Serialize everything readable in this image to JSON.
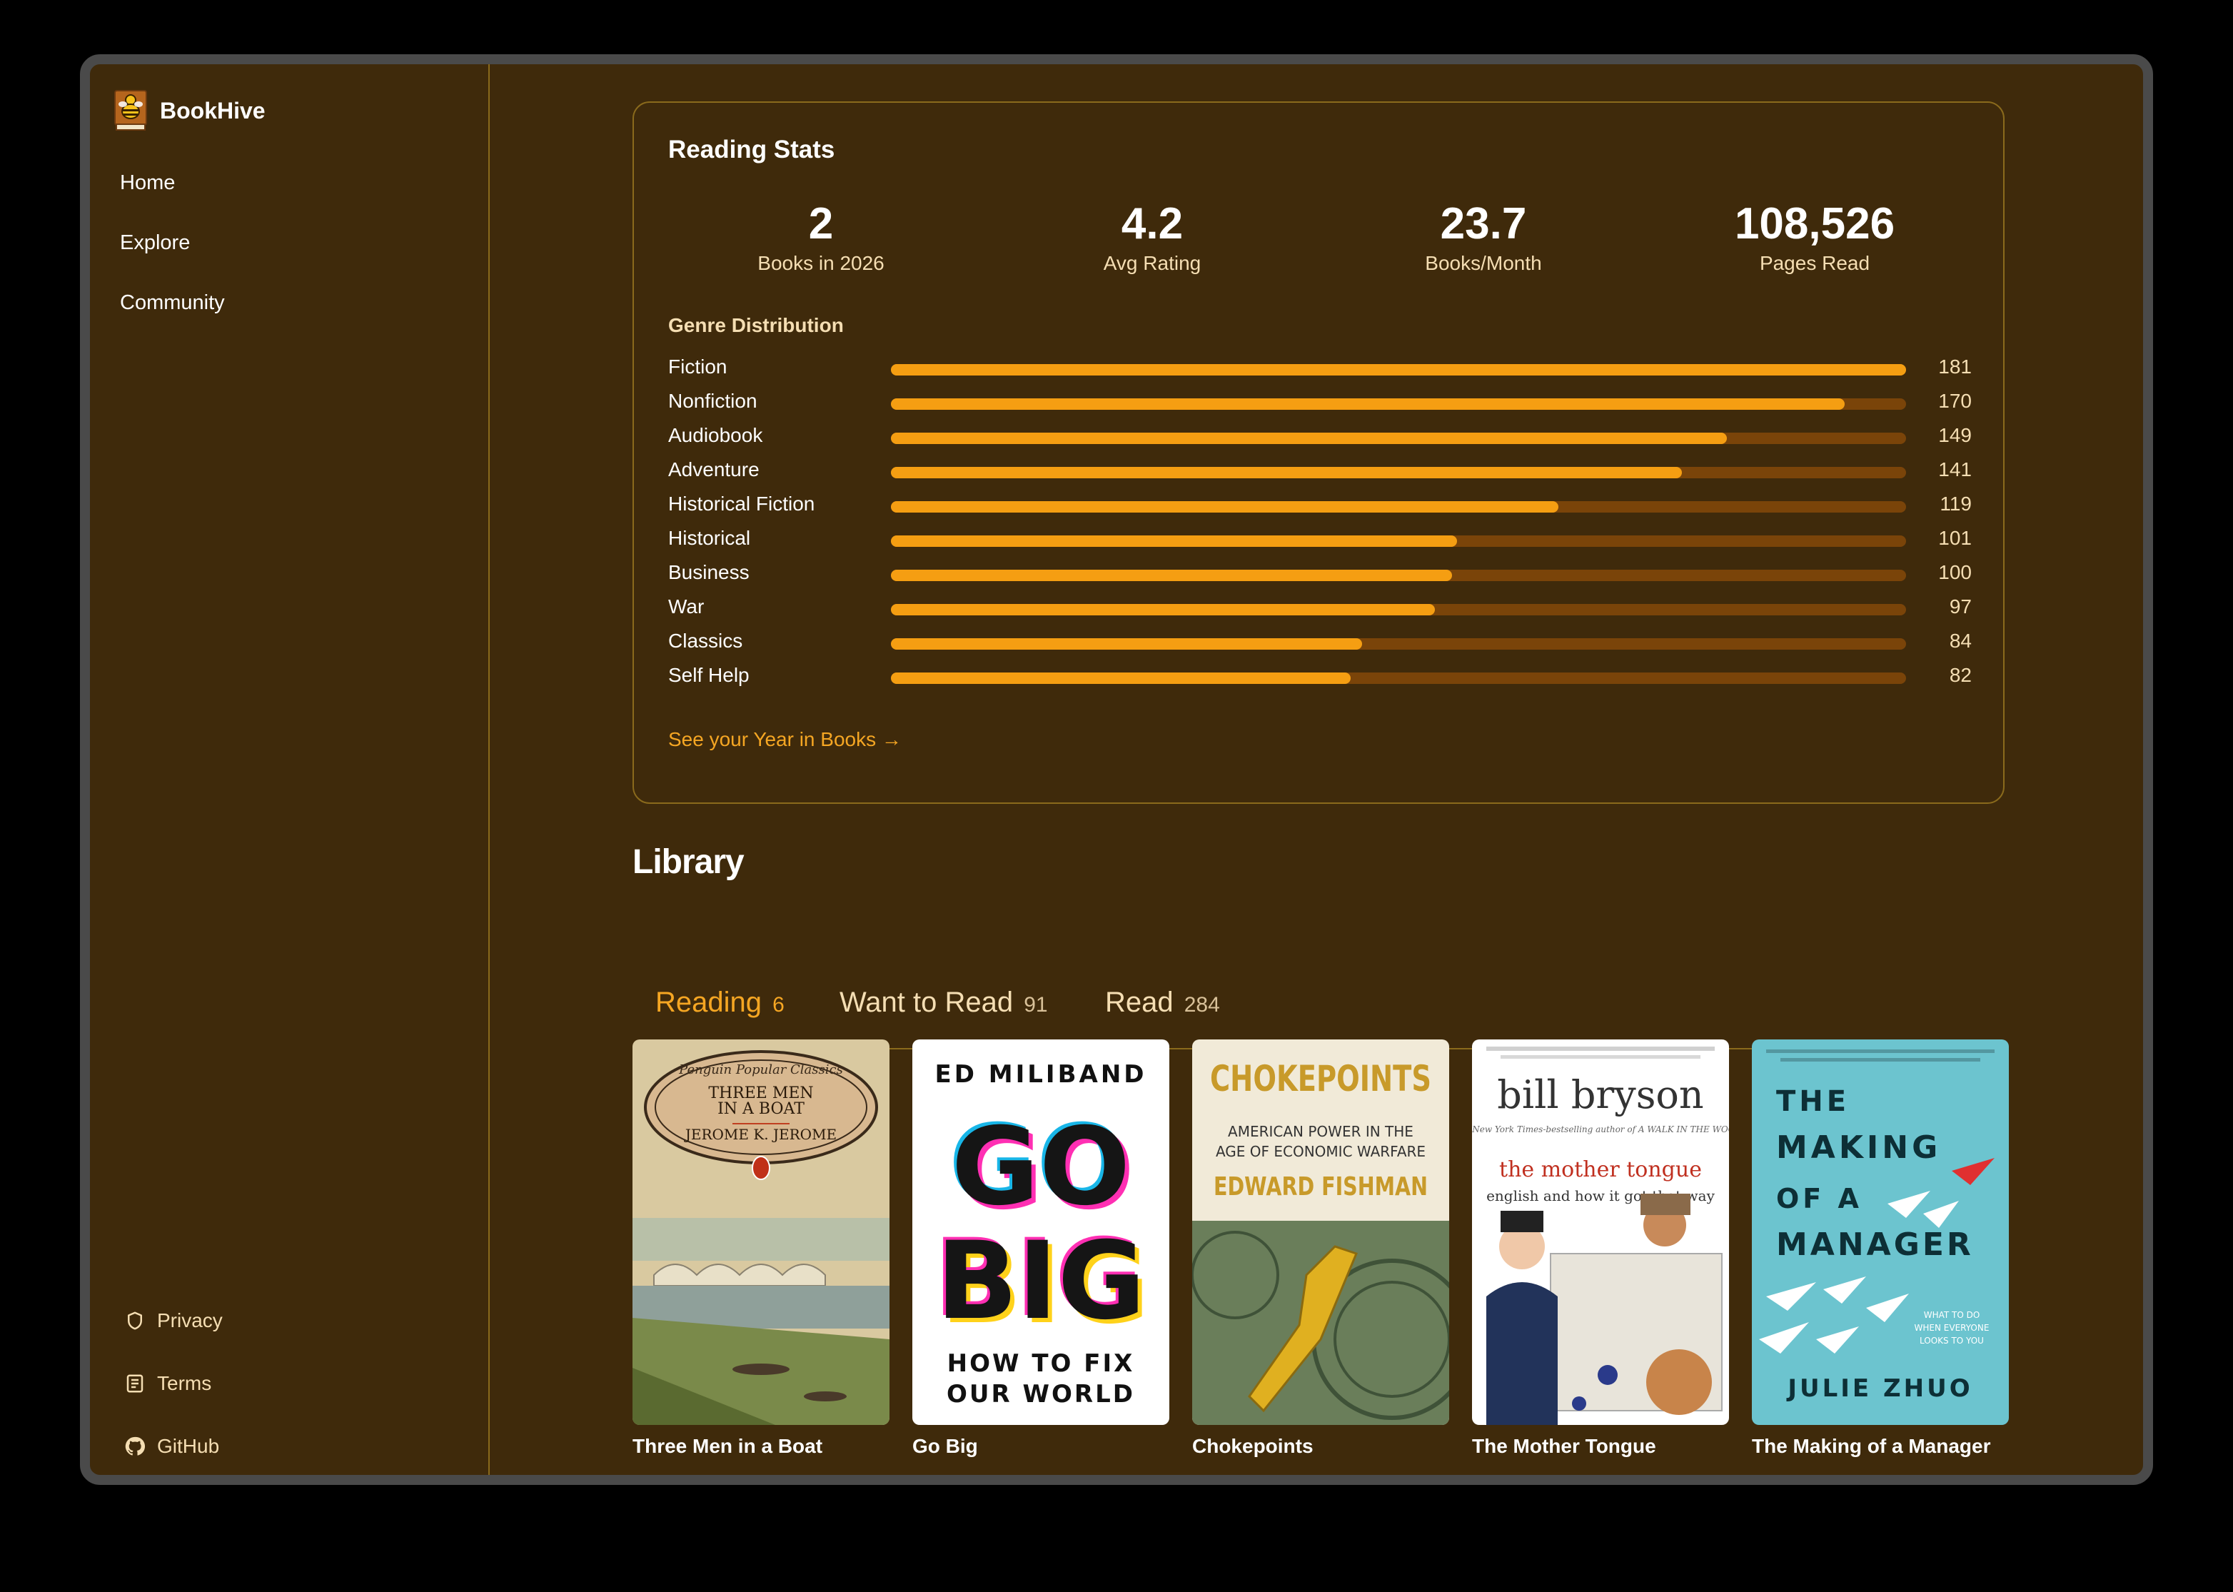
{
  "app": {
    "name": "BookHive"
  },
  "nav": [
    {
      "label": "Home"
    },
    {
      "label": "Explore"
    },
    {
      "label": "Community"
    }
  ],
  "footer": [
    {
      "label": "Privacy",
      "icon": "shield-icon"
    },
    {
      "label": "Terms",
      "icon": "document-icon"
    },
    {
      "label": "GitHub",
      "icon": "github-icon"
    }
  ],
  "stats": {
    "title": "Reading Stats",
    "items": [
      {
        "value": "2",
        "label": "Books in 2026"
      },
      {
        "value": "4.2",
        "label": "Avg Rating"
      },
      {
        "value": "23.7",
        "label": "Books/Month"
      },
      {
        "value": "108,526",
        "label": "Pages Read"
      }
    ],
    "genre_title": "Genre Distribution",
    "genres": [
      {
        "name": "Fiction",
        "count": 181
      },
      {
        "name": "Nonfiction",
        "count": 170
      },
      {
        "name": "Audiobook",
        "count": 149
      },
      {
        "name": "Adventure",
        "count": 141
      },
      {
        "name": "Historical Fiction",
        "count": 119
      },
      {
        "name": "Historical",
        "count": 101
      },
      {
        "name": "Business",
        "count": 100
      },
      {
        "name": "War",
        "count": 97
      },
      {
        "name": "Classics",
        "count": 84
      },
      {
        "name": "Self Help",
        "count": 82
      }
    ],
    "year_link": "See your Year in Books →"
  },
  "library": {
    "title": "Library",
    "tabs": [
      {
        "label": "Reading",
        "count": "6",
        "active": true
      },
      {
        "label": "Want to Read",
        "count": "91",
        "active": false
      },
      {
        "label": "Read",
        "count": "284",
        "active": false
      }
    ],
    "books": [
      {
        "title": "Three Men in a Boat",
        "cover": {
          "series": "Penguin Popular Classics",
          "line1": "THREE MEN",
          "line2": "IN A BOAT",
          "author": "JEROME K. JEROME"
        }
      },
      {
        "title": "Go Big",
        "cover": {
          "author": "ED MILIBAND",
          "line1": "GO",
          "line2": "BIG",
          "subtitle": "HOW TO FIX OUR WORLD"
        }
      },
      {
        "title": "Chokepoints",
        "cover": {
          "line1": "CHOKEPOINTS",
          "subtitle": "AMERICAN POWER IN THE AGE OF ECONOMIC WARFARE",
          "author": "EDWARD FISHMAN"
        }
      },
      {
        "title": "The Mother Tongue",
        "cover": {
          "author": "bill bryson",
          "tagline": "The New York Times-bestselling author of A WALK IN THE WOODS",
          "line1": "the mother tongue",
          "subtitle": "english and how it got that way"
        }
      },
      {
        "title": "The Making of a Manager",
        "cover": {
          "line1": "THE",
          "line2": "MAKING",
          "line3": "OF A",
          "line4": "MANAGER",
          "subtitle": "WHAT TO DO WHEN EVERYONE LOOKS TO YOU",
          "author": "JULIE ZHUO"
        }
      }
    ]
  },
  "colors": {
    "background": "#3f2a0b",
    "accent": "#f5a623",
    "bar_fill": "#f59e12",
    "bar_track": "#7a4409",
    "border": "#8a6a1c"
  }
}
